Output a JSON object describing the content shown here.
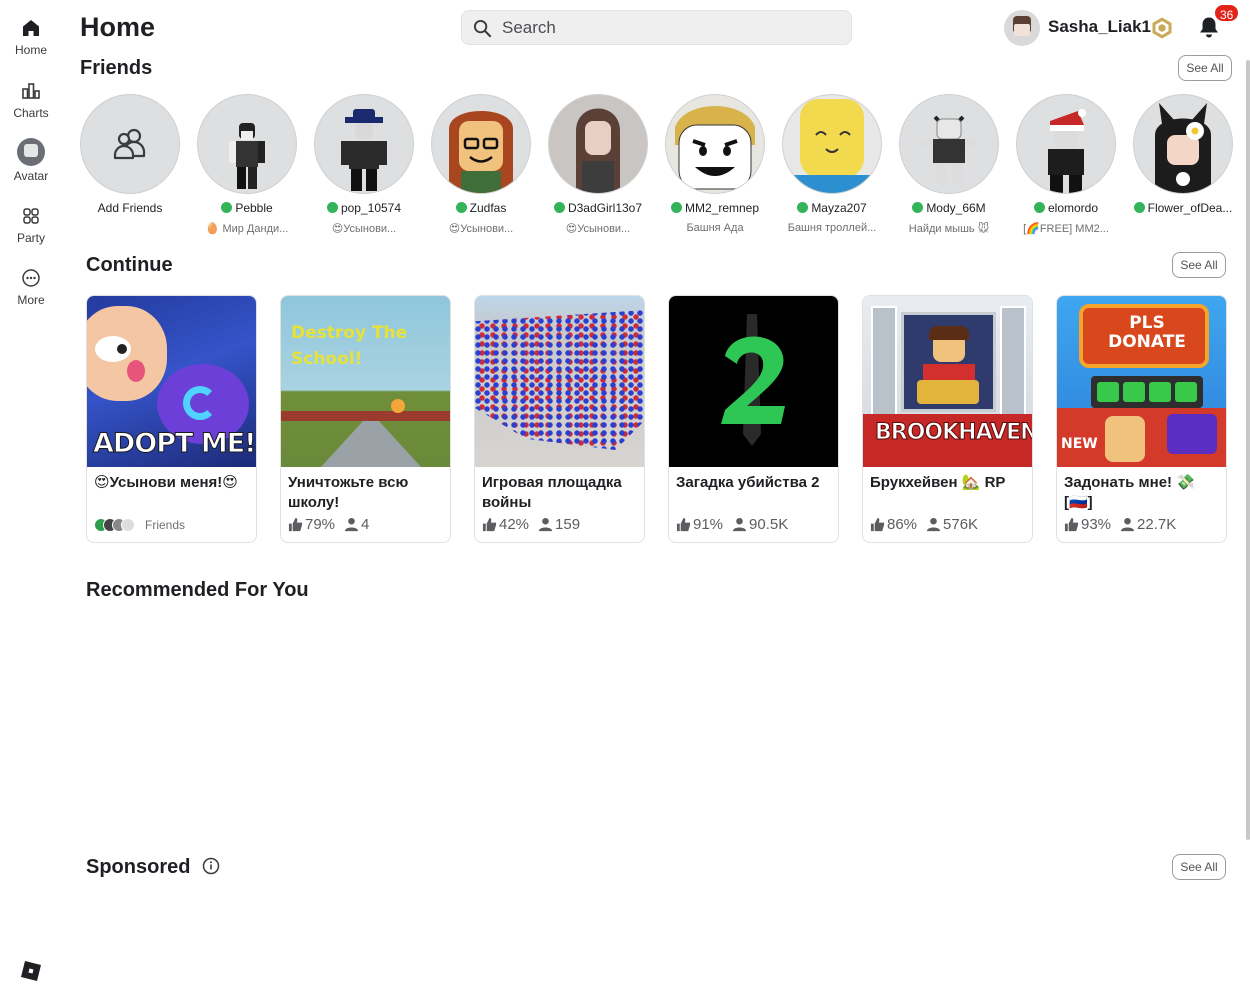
{
  "nav": {
    "items": [
      {
        "label": "Home",
        "icon": "home-icon"
      },
      {
        "label": "Charts",
        "icon": "charts-icon"
      },
      {
        "label": "Avatar",
        "icon": "avatar-icon"
      },
      {
        "label": "Party",
        "icon": "party-icon"
      },
      {
        "label": "More",
        "icon": "more-icon"
      }
    ]
  },
  "header": {
    "title": "Home",
    "search_placeholder": "Search",
    "username": "Sasha_Liak1",
    "notification_count": "36"
  },
  "friends": {
    "title": "Friends",
    "see_all": "See All",
    "add_label": "Add Friends",
    "items": [
      {
        "name": "Pebble",
        "status": "🥚 Мир Данди..."
      },
      {
        "name": "pop_10574",
        "status": "😍Усынови..."
      },
      {
        "name": "Zudfas",
        "status": "😍Усынови..."
      },
      {
        "name": "D3adGirl13o7",
        "status": "😍Усынови..."
      },
      {
        "name": "MM2_remnep",
        "status": "Башня Ада"
      },
      {
        "name": "Mayza207",
        "status": "Башня троллей..."
      },
      {
        "name": "Mody_66M",
        "status": "Найди мышь 🐭"
      },
      {
        "name": "elomordo",
        "status": "[🌈FREE] MM2..."
      },
      {
        "name": "Flower_ofDea...",
        "status": ""
      }
    ]
  },
  "continue": {
    "title": "Continue",
    "see_all": "See All",
    "games": [
      {
        "title": "😍Усынови меня!😍",
        "friends_label": "Friends",
        "thumb_text": "ADOPT ME!"
      },
      {
        "title": "Уничтожьте всю школу!",
        "rating": "79%",
        "players": "4",
        "thumb_text": "Destroy The School!"
      },
      {
        "title": "Игровая площадка войны",
        "rating": "42%",
        "players": "159"
      },
      {
        "title": "Загадка убийства 2",
        "rating": "91%",
        "players": "90.5K"
      },
      {
        "title": "Брукхейвен 🏡 RP",
        "rating": "86%",
        "players": "576K",
        "thumb_text": "BROOKHAVEN"
      },
      {
        "title": "Задонать мне! 💸 [🇷🇺]",
        "rating": "93%",
        "players": "22.7K",
        "thumb_text": "PLS DONATE",
        "thumb_badge": "NEW"
      }
    ]
  },
  "recommended": {
    "title": "Recommended For You"
  },
  "sponsored": {
    "title": "Sponsored",
    "see_all": "See All"
  },
  "colors": {
    "online": "#33b35a",
    "notification": "#e2231a",
    "accent": "#1f2023"
  }
}
